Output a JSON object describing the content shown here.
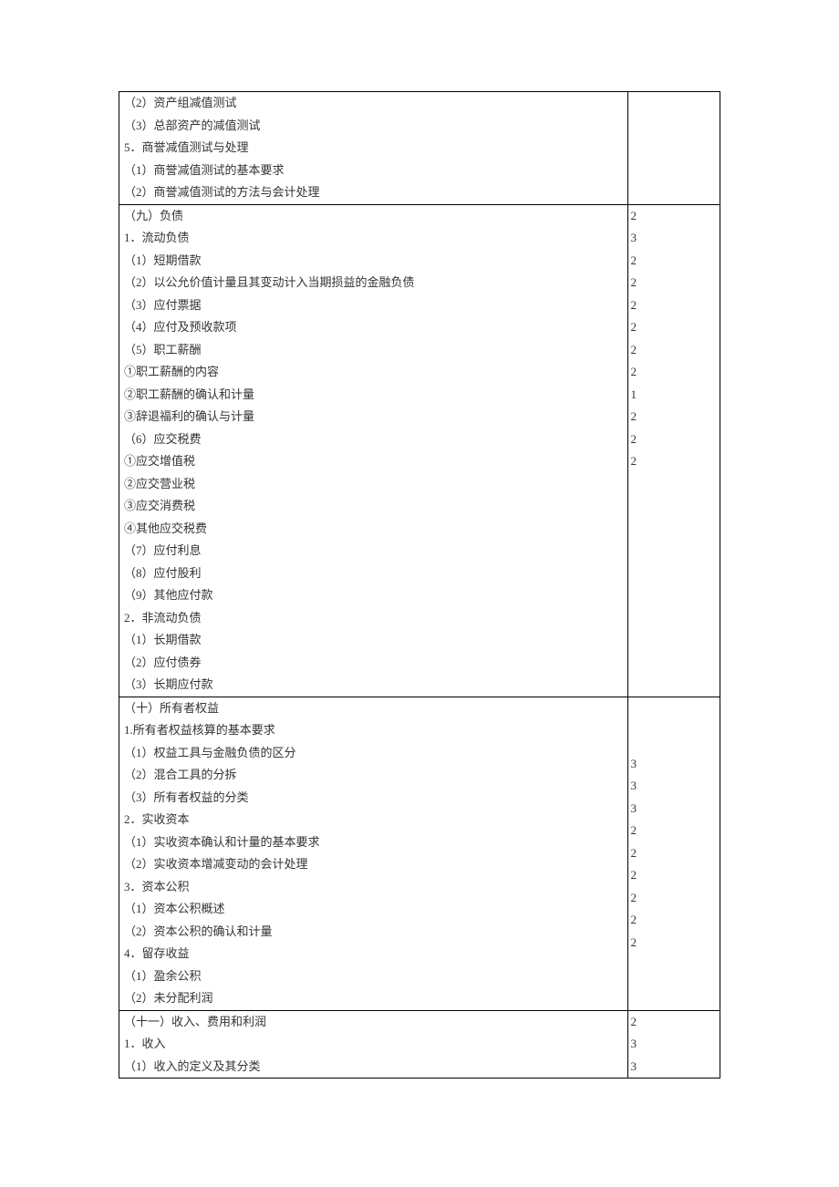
{
  "groups": [
    {
      "left": [
        "（2）资产组减值测试",
        "（3）总部资产的减值测试",
        "5．商誉减值测试与处理",
        "（1）商誉减值测试的基本要求",
        "（2）商誉减值测试的方法与会计处理"
      ],
      "right": []
    },
    {
      "left": [
        "（九）负债",
        "1．流动负债",
        "（1）短期借款",
        "（2）以公允价值计量且其变动计入当期损益的金融负债",
        "（3）应付票据",
        "（4）应付及预收款项",
        "（5）职工薪酬",
        "①职工薪酬的内容",
        "②职工薪酬的确认和计量",
        "③辞退福利的确认与计量",
        "（6）应交税费",
        "①应交增值税",
        "②应交营业税",
        "③应交消费税",
        "④其他应交税费",
        "（7）应付利息",
        "（8）应付股利",
        "（9）其他应付款",
        "2．非流动负债",
        "（1）长期借款",
        "（2）应付债券",
        "（3）长期应付款"
      ],
      "right": [
        "",
        "",
        "",
        "",
        "",
        "2",
        "3",
        "2",
        "2",
        "2",
        "2",
        "2",
        "2",
        "1",
        "2",
        "2",
        "2",
        "",
        "",
        "",
        "",
        ""
      ]
    },
    {
      "left": [
        "（十）所有者权益",
        "1.所有者权益核算的基本要求",
        "（1）权益工具与金融负债的区分",
        "（2）混合工具的分拆",
        "（3）所有者权益的分类",
        "2．实收资本",
        "（1）实收资本确认和计量的基本要求",
        "（2）实收资本增减变动的会计处理",
        "3．资本公积",
        "（1）资本公积概述",
        "（2）资本公积的确认和计量",
        "4．留存收益",
        "（1）盈余公积",
        "（2）未分配利润"
      ],
      "right": [
        "3",
        "3",
        "3",
        "2",
        "2",
        "2",
        "2",
        "2",
        "2"
      ],
      "rightVAlign": "middle"
    },
    {
      "left": [
        "（十一）收入、费用和利润",
        "1．收入",
        "（1）收入的定义及其分类"
      ],
      "right": [
        "2",
        "3",
        "3"
      ]
    }
  ]
}
